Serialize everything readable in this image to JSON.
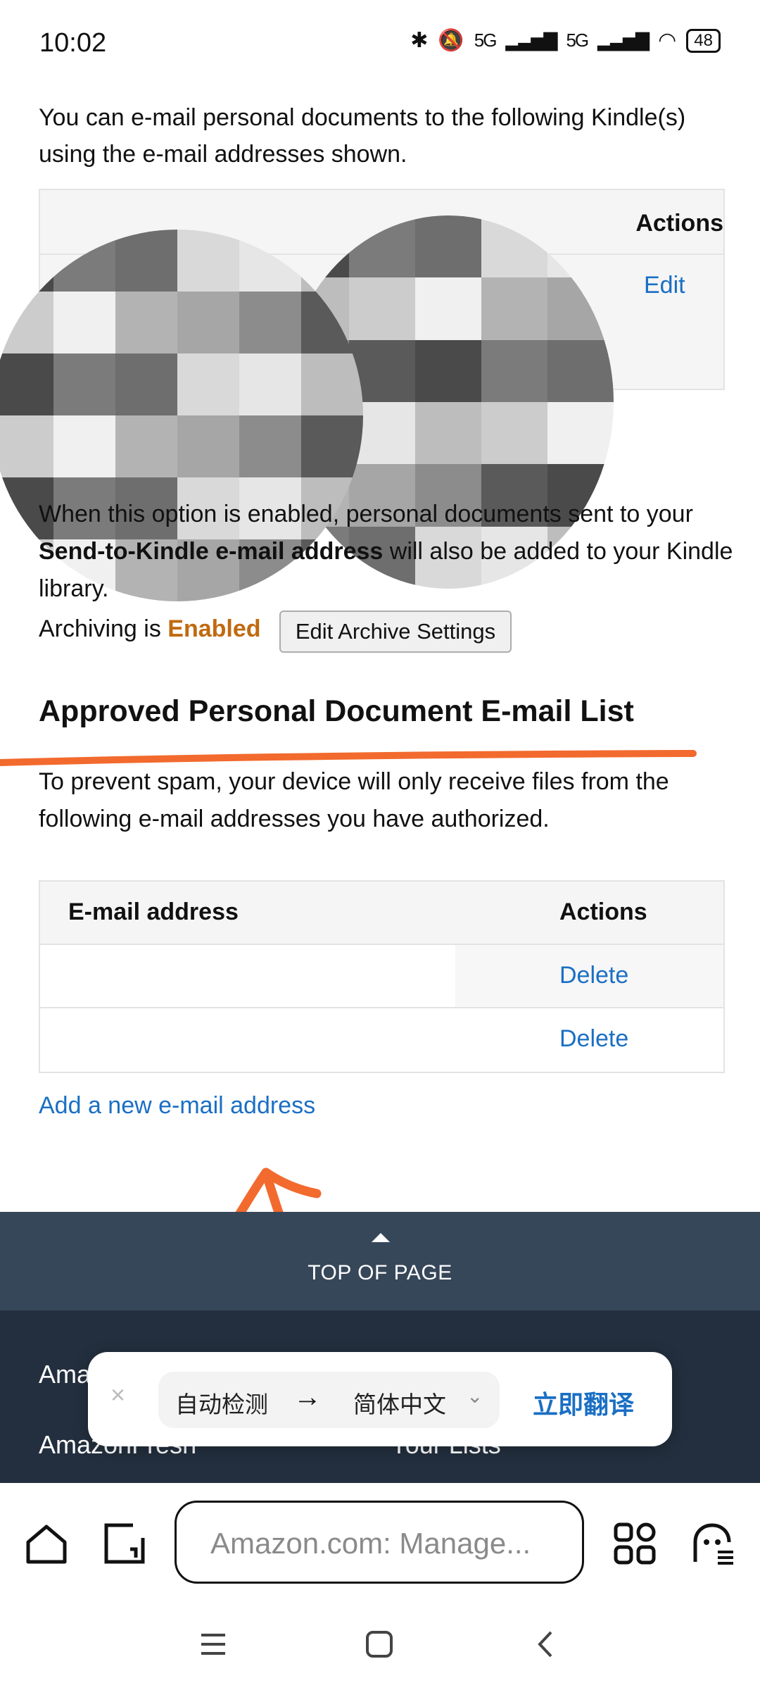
{
  "status_bar": {
    "time": "10:02",
    "signal_1": "5G",
    "signal_2": "5G",
    "battery": "48"
  },
  "kindle_section": {
    "intro": "You can e-mail personal documents to the following Kindle(s) using the e-mail addresses shown.",
    "actions_header": "Actions",
    "edit_link": "Edit"
  },
  "archive": {
    "description_prefix": "When this option is enabled, personal documents sent to your ",
    "description_bold": "Send-to-Kindle e-mail address",
    "description_suffix": " will also be added to your Kindle library.",
    "status_prefix": "Archiving is ",
    "status_value": "Enabled",
    "button_label": "Edit Archive Settings"
  },
  "approved_list": {
    "title": "Approved Personal Document E-mail List",
    "description": "To prevent spam, your device will only receive files from the following e-mail addresses you have authorized.",
    "col_email": "E-mail address",
    "col_actions": "Actions",
    "rows": [
      {
        "delete_label": "Delete"
      },
      {
        "delete_label": "Delete"
      }
    ],
    "add_link": "Add a new e-mail address"
  },
  "footer": {
    "back_to_top": "TOP OF PAGE",
    "links": [
      "Ama",
      "AmazonFresh",
      "Your Lists"
    ]
  },
  "translate_bar": {
    "close": "×",
    "source_lang": "自动检测",
    "arrow": "→",
    "target_lang": "简体中文",
    "chevron": "⌄",
    "translate_now": "立即翻译"
  },
  "browser": {
    "url_text": "Amazon.com: Manage..."
  },
  "colors": {
    "link": "#1a6fc4",
    "enabled": "#c06a10",
    "footer_top": "#37475a",
    "footer_bottom": "#232f3e",
    "annotation": "#f26a2e"
  },
  "icons": [
    "bluetooth-icon",
    "mute-icon",
    "wifi-icon",
    "home-icon",
    "tabs-icon",
    "apps-icon",
    "ghost-icon",
    "menu-icon",
    "square-icon",
    "back-icon"
  ]
}
